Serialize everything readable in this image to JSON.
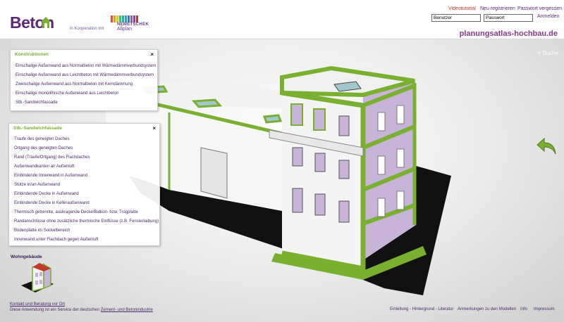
{
  "header": {
    "logo_text": "Beton",
    "kooperation": "in Kooperation mit",
    "partner_line1": "NEMETSCHEK",
    "partner_line2": "Allplan",
    "links": {
      "videotutorial": "Videotutorial",
      "register": "Neu registrieren",
      "forgot": "Passwort vergessen"
    },
    "login": {
      "user_value": "Benutzer",
      "password_value": "Passwort",
      "button": "Anmelden"
    },
    "site": "planungsatlas-hochbau.de"
  },
  "search_link": "< Suche",
  "panel_konstruktionen": {
    "title": "Konstruktionen",
    "close": "×",
    "items": [
      "Einschalige Außenwand aus Normalbeton mit Wärmedämmverbundsystem",
      "Einschalige Außenwand aus Leichtbeton mit Wärmedämmverbundsystem",
      "Zweischalige Außenwand aus Normalbeton mit Kerndämmung",
      "Einschalige monolithische Außenwand aus Leichtbeton",
      "Stb.-Sandwichfassade"
    ]
  },
  "panel_sandwich": {
    "title": "Stb.-Sandwichfassade",
    "close": "×",
    "items": [
      "Traufe des geneigten Daches",
      "Ortgang des geneigten Daches",
      "Rand (Traufe/Ortgang) des Flachdaches",
      "Außenwandkanten an Außenluft",
      "Einbindende Innenwand in Außenwand",
      "Stütze in/an Außenwand",
      "Einbindende Decke in Außenwand",
      "Einbindende Decke in Kelleraußenwand",
      "Thermisch getrennte, auskragende Decke/Balkon- bzw. Trogplatte",
      "Randanschlüsse ohne zusätzliche thermische Einflüsse (z.B. Fensterlaibung)",
      "Bodenplatte im Sockelbereich",
      "Innenwand unter Flachdach gegen Außenluft"
    ]
  },
  "thumbnail_label": "Wohngebäude",
  "footer": {
    "contact": "Kontakt und Beratung vor Ort",
    "service_prefix": "Diese Anwendung ist ein Service der deutschen ",
    "service_link": "Zement- und Betonindustrie",
    "links": [
      "Einleitung - Hintergrund - Literatur",
      "Anmerkungen zu den Modellen",
      "Info",
      "Impressum"
    ]
  },
  "colors": {
    "brand_purple": "#5d2a7b",
    "accent_green": "#7ab030",
    "facade_lilac": "#c7b4d8"
  }
}
